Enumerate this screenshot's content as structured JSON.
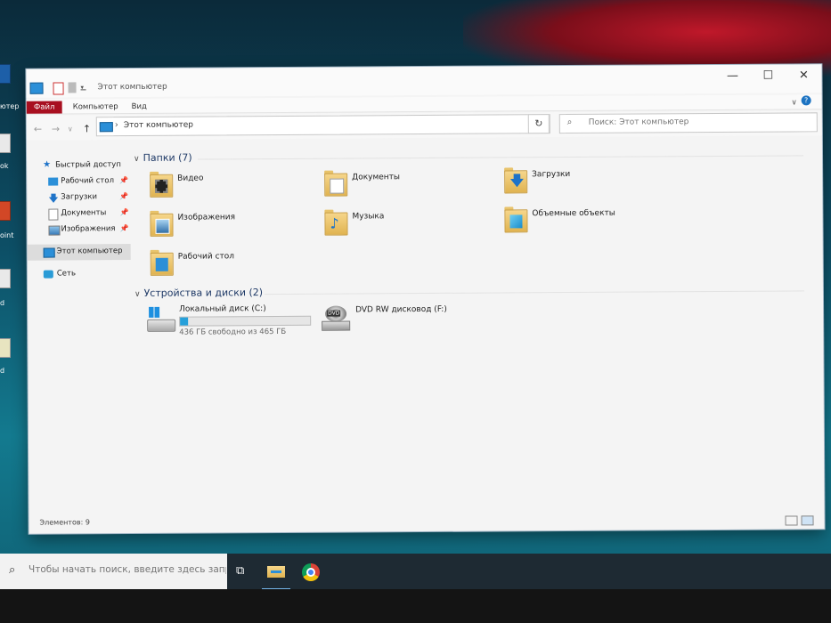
{
  "window": {
    "title": "Этот компьютер",
    "minimize": "—",
    "maximize": "☐",
    "close": "✕"
  },
  "ribbon": {
    "tabs": [
      "Файл",
      "Компьютер",
      "Вид"
    ],
    "collapse": "∨",
    "help": "?"
  },
  "navigation": {
    "back": "←",
    "forward": "→",
    "up": "↑",
    "address_separator": "›",
    "address": "Этот компьютер",
    "dropdown": "∨",
    "refresh": "↻",
    "search_placeholder": "Поиск: Этот компьютер"
  },
  "sidebar": {
    "quick_access": "Быстрый доступ",
    "pin": "📌",
    "pinned": [
      {
        "label": "Рабочий стол",
        "icon": "desktop-icon"
      },
      {
        "label": "Загрузки",
        "icon": "download-icon"
      },
      {
        "label": "Документы",
        "icon": "document-icon"
      },
      {
        "label": "Изображения",
        "icon": "image-icon"
      }
    ],
    "this_pc": "Этот компьютер",
    "network": "Сеть"
  },
  "folders_group": {
    "title": "Папки (7)",
    "chevron": "∨",
    "items": [
      {
        "label": "Видео",
        "icon": "video-folder-icon"
      },
      {
        "label": "Документы",
        "icon": "documents-folder-icon"
      },
      {
        "label": "Загрузки",
        "icon": "downloads-folder-icon"
      },
      {
        "label": "Изображения",
        "icon": "pictures-folder-icon"
      },
      {
        "label": "Музыка",
        "icon": "music-folder-icon"
      },
      {
        "label": "Объемные объекты",
        "icon": "3d-objects-folder-icon"
      },
      {
        "label": "Рабочий стол",
        "icon": "desktop-folder-icon"
      }
    ]
  },
  "drives_group": {
    "title": "Устройства и диски (2)",
    "chevron": "∨",
    "drives": [
      {
        "label": "Локальный диск (C:)",
        "free_text": "436 ГБ свободно из 465 ГБ",
        "used_fraction": 0.0624,
        "icon": "hard-drive-icon"
      },
      {
        "label": "DVD RW дисковод (F:)",
        "icon": "dvd-drive-icon",
        "dvd_text": "DVD"
      }
    ]
  },
  "status": {
    "items_count": "Элементов: 9"
  },
  "taskbar": {
    "search_placeholder": "Чтобы начать поиск, введите здесь запрос",
    "task_view": "⧉"
  },
  "desktop": {
    "labels": [
      "ютер",
      "ok",
      "oint",
      "d",
      "d"
    ]
  },
  "colors": {
    "file_tab": "#a80f20",
    "accent": "#26a0da",
    "group_title": "#1e3966"
  }
}
